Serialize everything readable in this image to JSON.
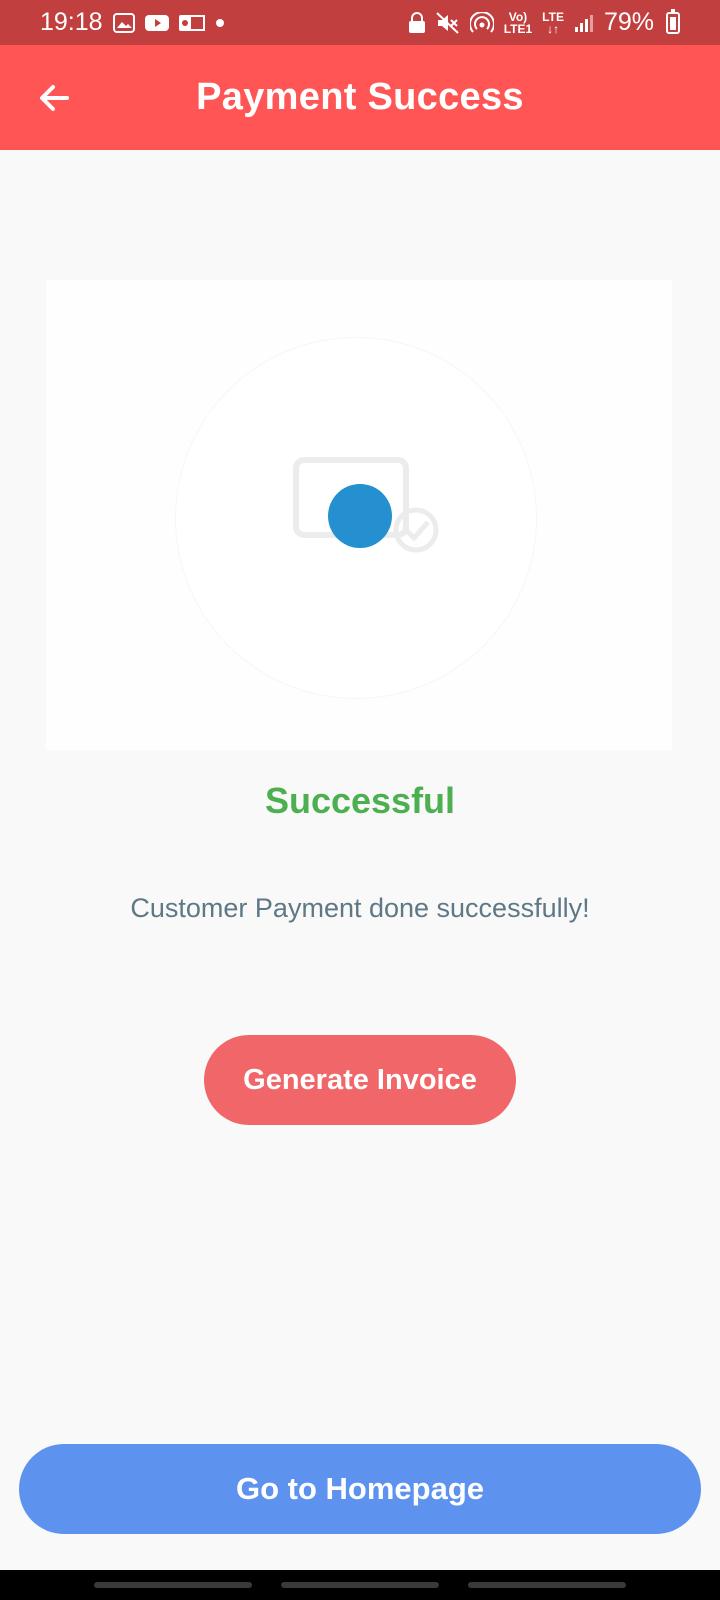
{
  "status_bar": {
    "time": "19:18",
    "battery": "79%",
    "left_icons": [
      "gallery-icon",
      "youtube-icon",
      "outlook-icon",
      "dot-indicator"
    ],
    "right_icons": [
      "lock-icon",
      "mute-icon",
      "hotspot-icon",
      "volte-icon",
      "lte-icon",
      "signal-icon",
      "battery-icon"
    ],
    "volte_top": "Vo)",
    "volte_bottom": "LTE1",
    "lte_label": "LTE"
  },
  "app_bar": {
    "title": "Payment Success",
    "background": "#ff5555"
  },
  "result": {
    "title": "Successful",
    "title_color": "#4caf50",
    "message": "Customer Payment done successfully!"
  },
  "actions": {
    "invoice_label": "Generate Invoice",
    "invoice_color": "#f16769",
    "home_label": "Go to Homepage",
    "home_color": "#5d93ef"
  }
}
